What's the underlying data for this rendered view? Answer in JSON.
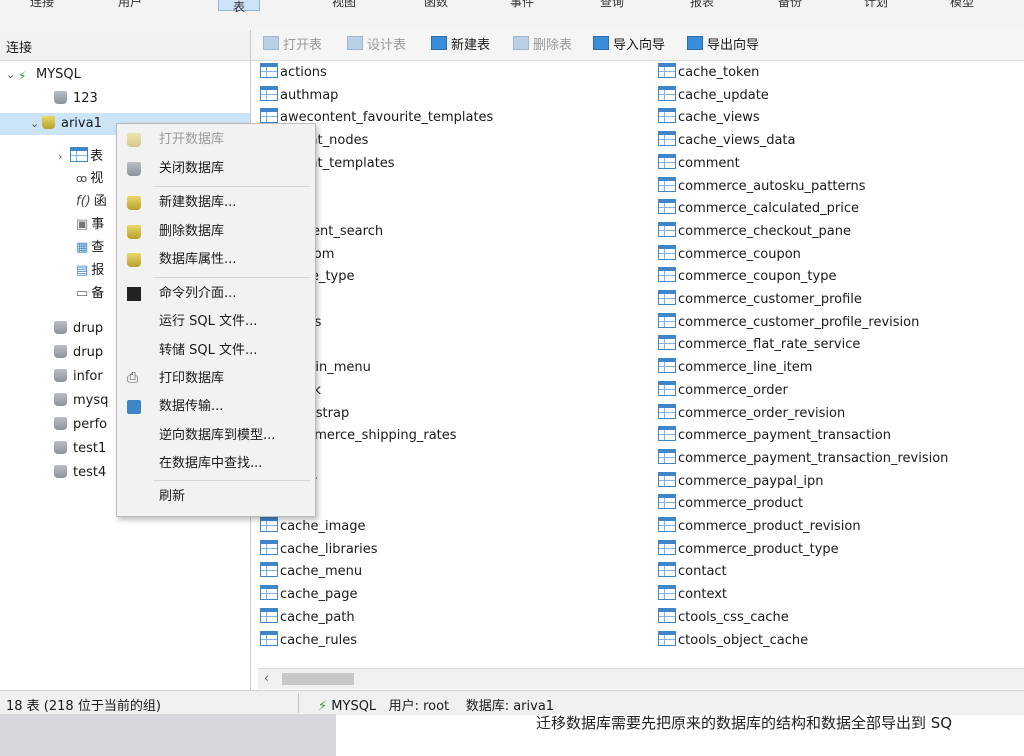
{
  "ribbon": {
    "tabs": [
      "连接",
      "用户",
      "表",
      "视图",
      "函数",
      "事件",
      "查询",
      "报表",
      "备份",
      "计划",
      "模型"
    ],
    "active": "表"
  },
  "left": {
    "header": "连接",
    "tree": {
      "conn": "MYSQL",
      "db_123": "123",
      "db_ariva1": "ariva1",
      "sub_tables": "表",
      "sub_views": "视",
      "sub_funcs": "函",
      "sub_events": "事",
      "sub_queries": "查",
      "sub_reports": "报",
      "sub_backup": "备",
      "db_drup1": "drup",
      "db_drup2": "drup",
      "db_infor": "infor",
      "db_mysq": "mysq",
      "db_perf": "perfo",
      "db_test1": "test1",
      "db_test4": "test4"
    }
  },
  "toolbar": {
    "open": "打开表",
    "design": "设计表",
    "new": "新建表",
    "delete": "删除表",
    "import": "导入向导",
    "export": "导出向导"
  },
  "tables_col1": [
    "actions",
    "authmap",
    "awecontent_favourite_templates",
    "awecontent_nodes",
    "awecontent_templates",
    "",
    "",
    "cache_current_search",
    "cache_custom",
    "cache_node_type",
    "cache_role",
    "blocked_ips",
    "",
    "cache_admin_menu",
    "cache_block",
    "cache_bootstrap",
    "cache_commerce_shipping_rates",
    "cache_field",
    "cache_filter",
    "cache_form",
    "cache_image",
    "cache_libraries",
    "cache_menu",
    "cache_page",
    "cache_path",
    "cache_rules"
  ],
  "tables_col1_visible": [
    "actions",
    "authmap",
    "awecontent_favourite_templates",
    "ontent_nodes",
    "ontent_templates",
    "",
    "",
    "_current_search",
    "_custom",
    "_node_type",
    "_role",
    "ed_ips",
    "",
    "_admin_menu",
    "_block",
    "_bootstrap",
    "_commerce_shipping_rates",
    "_field",
    "_filter",
    "_form",
    "cache_image",
    "cache_libraries",
    "cache_menu",
    "cache_page",
    "cache_path",
    "cache_rules"
  ],
  "tables_col2": [
    "cache_token",
    "cache_update",
    "cache_views",
    "cache_views_data",
    "comment",
    "commerce_autosku_patterns",
    "commerce_calculated_price",
    "commerce_checkout_pane",
    "commerce_coupon",
    "commerce_coupon_type",
    "commerce_customer_profile",
    "commerce_customer_profile_revision",
    "commerce_flat_rate_service",
    "commerce_line_item",
    "commerce_order",
    "commerce_order_revision",
    "commerce_payment_transaction",
    "commerce_payment_transaction_revision",
    "commerce_paypal_ipn",
    "commerce_product",
    "commerce_product_revision",
    "commerce_product_type",
    "contact",
    "context",
    "ctools_css_cache",
    "ctools_object_cache"
  ],
  "context_menu": {
    "open_db": "打开数据库",
    "close_db": "关闭数据库",
    "new_db": "新建数据库...",
    "delete_db": "删除数据库",
    "db_props": "数据库属性...",
    "console": "命令列介面...",
    "run_sql": "运行 SQL 文件...",
    "dump_sql": "转储 SQL 文件...",
    "print_db": "打印数据库",
    "transfer": "数据传输...",
    "reverse": "逆向数据库到模型...",
    "find": "在数据库中查找...",
    "refresh": "刷新"
  },
  "status": {
    "left": "18 表 (218 位于当前的组)",
    "conn": "MYSQL",
    "user": "用户: root",
    "db": "数据库: ariva1"
  },
  "bottom_text": "迁移数据库需要先把原来的数据库的结构和数据全部导出到 SQ",
  "colors": {
    "accent": "#cce4f7",
    "menu_bg": "#f2f2f2",
    "table_icon": "#3f86c8"
  }
}
